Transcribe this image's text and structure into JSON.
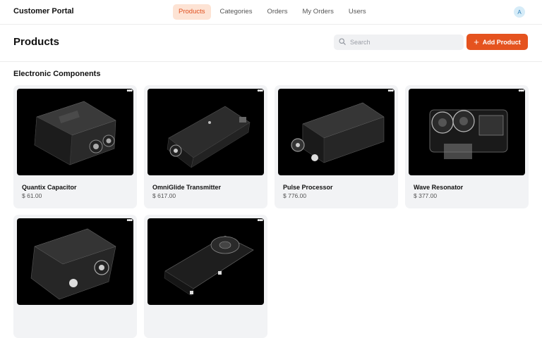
{
  "app": {
    "title": "Customer Portal",
    "avatar_initial": "A"
  },
  "nav": {
    "items": [
      {
        "label": "Products",
        "active": true
      },
      {
        "label": "Categories",
        "active": false
      },
      {
        "label": "Orders",
        "active": false
      },
      {
        "label": "My Orders",
        "active": false
      },
      {
        "label": "Users",
        "active": false
      }
    ]
  },
  "page": {
    "title": "Products"
  },
  "search": {
    "placeholder": "Search",
    "value": "",
    "icon": "search-icon"
  },
  "toolbar": {
    "add_label": "Add Product",
    "add_icon": "plus-icon"
  },
  "section": {
    "title": "Electronic Components"
  },
  "products": [
    {
      "name": "Quantix Capacitor",
      "price": "$ 61.00"
    },
    {
      "name": "OmniGlide Transmitter",
      "price": "$ 617.00"
    },
    {
      "name": "Pulse Processor",
      "price": "$ 776.00"
    },
    {
      "name": "Wave Resonator",
      "price": "$ 377.00"
    },
    {
      "name": "",
      "price": ""
    },
    {
      "name": "",
      "price": ""
    }
  ],
  "colors": {
    "accent": "#e5531f",
    "active_nav_bg": "#fde3d4",
    "card_bg": "#f2f3f5"
  }
}
